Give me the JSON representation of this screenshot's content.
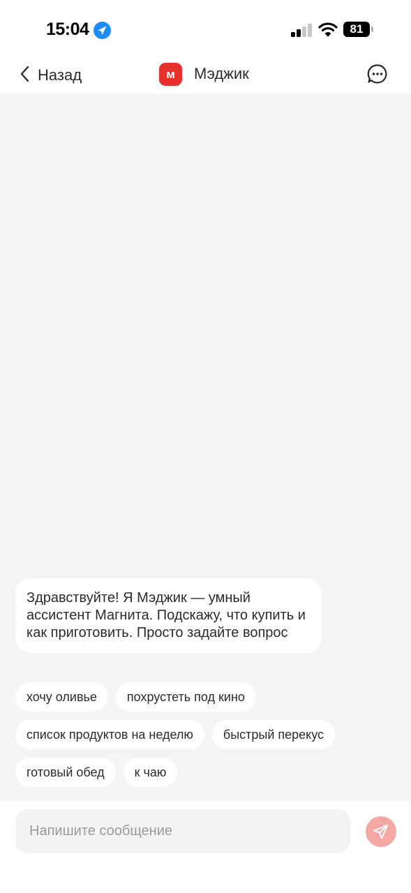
{
  "status_bar": {
    "time": "15:04",
    "battery": "81",
    "location_icon": "location-arrow-icon",
    "signal_icon": "cellular-signal-icon",
    "wifi_icon": "wifi-icon"
  },
  "nav": {
    "back_label": "Назад",
    "title": "Мэджик",
    "logo_letter": "м",
    "back_icon": "chevron-left-icon",
    "menu_icon": "chat-bubble-dots-icon"
  },
  "chat": {
    "greeting": "Здравствуйте! Я Мэджик — умный ассистент Магнита. Подскажу, что купить и как приготовить. Просто задайте вопрос",
    "suggestions": [
      "хочу оливье",
      "похрустеть под кино",
      "список продуктов на неделю",
      "быстрый перекус",
      "готовый обед",
      "к чаю"
    ]
  },
  "input": {
    "placeholder": "Напишите сообщение",
    "value": "",
    "send_icon": "send-paper-plane-icon"
  },
  "colors": {
    "brand_red": "#e8302b",
    "send_disabled": "#f5a7a4",
    "chat_background": "#f4f4f2",
    "location_blue": "#1d8cf8"
  }
}
